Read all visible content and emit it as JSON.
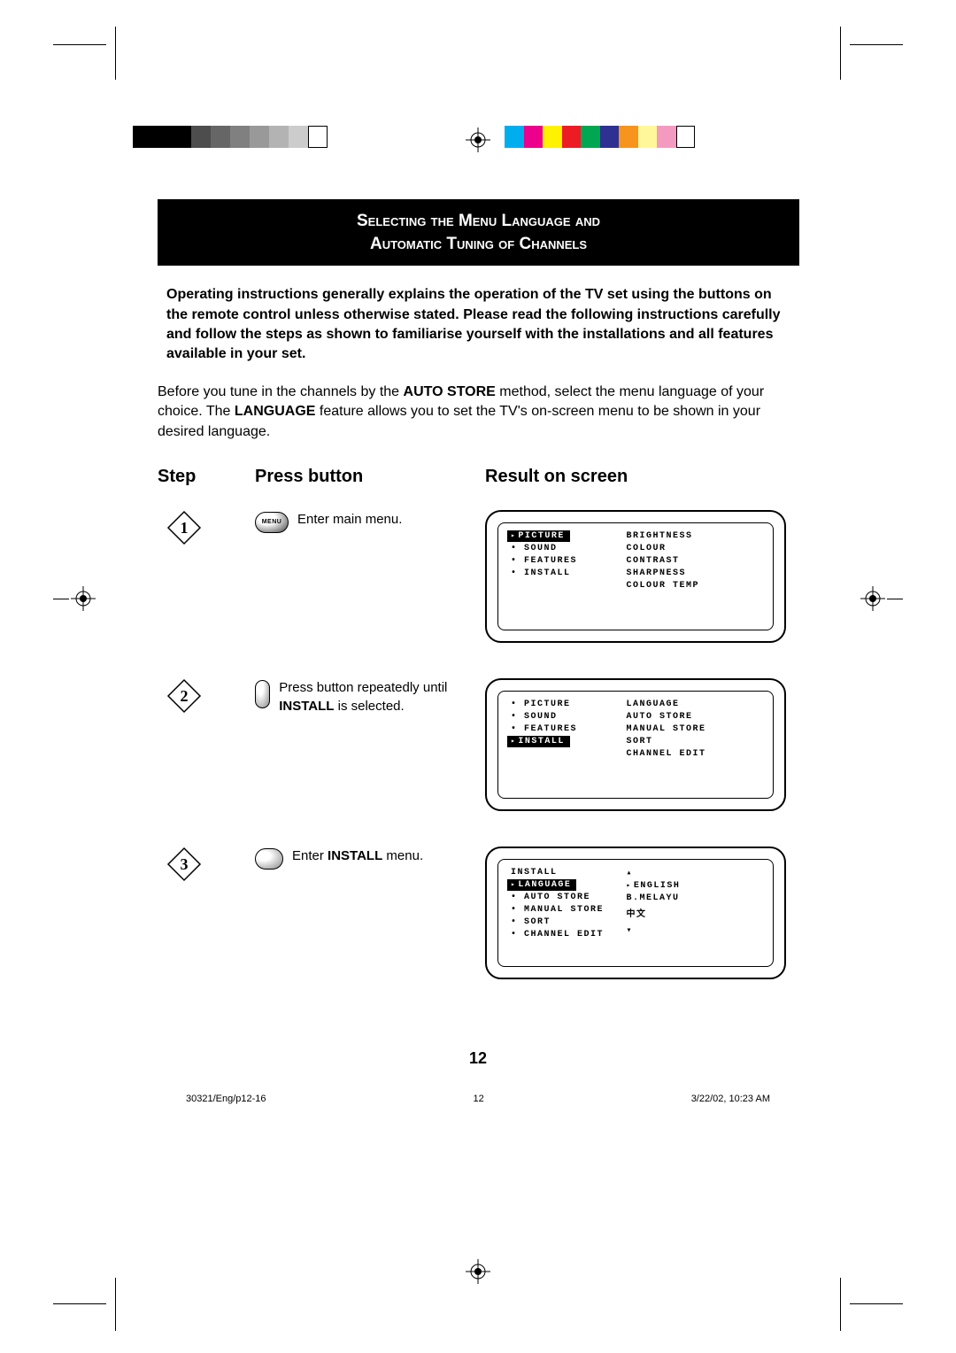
{
  "title_line1": "Selecting the Menu Language  and",
  "title_line2": "Automatic Tuning of Channels",
  "intro_bold": "Operating instructions generally explains the operation of the TV set using the buttons on the remote control unless otherwise stated.  Please read the following instructions carefully and follow the steps as shown to familiarise yourself with the installations and all features available in your set.",
  "intro_pre": "Before you tune in the channels by the ",
  "intro_bold2": "AUTO STORE",
  "intro_mid": " method, select the menu language of your choice.  The ",
  "intro_bold3": "LANGUAGE",
  "intro_post": " feature allows you to set the TV's on-screen menu to be shown in your desired language.",
  "headers": {
    "step": "Step",
    "press": "Press button",
    "result": "Result on screen"
  },
  "steps": {
    "s1": {
      "num": "1",
      "btn_label": "MENU",
      "text": "Enter main menu."
    },
    "s2": {
      "num": "2",
      "text_pre": "Press button repeatedly until ",
      "text_bold": "INSTALL",
      "text_post": " is selected."
    },
    "s3": {
      "num": "3",
      "text_pre": "Enter ",
      "text_bold": "INSTALL",
      "text_post": " menu."
    }
  },
  "screen1": {
    "left": [
      "PICTURE",
      "SOUND",
      "FEATURES",
      "INSTALL"
    ],
    "left_sel": 0,
    "right": [
      "BRIGHTNESS",
      "COLOUR",
      "CONTRAST",
      "SHARPNESS",
      "COLOUR TEMP"
    ]
  },
  "screen2": {
    "left": [
      "PICTURE",
      "SOUND",
      "FEATURES",
      "INSTALL"
    ],
    "left_sel": 3,
    "right": [
      "LANGUAGE",
      "AUTO STORE",
      "MANUAL STORE",
      "SORT",
      "CHANNEL EDIT"
    ]
  },
  "screen3": {
    "left": [
      "INSTALL",
      "LANGUAGE",
      "AUTO STORE",
      "MANUAL STORE",
      "SORT",
      "CHANNEL EDIT"
    ],
    "left_sel": 1,
    "right": [
      "▴",
      "ENGLISH",
      "B.MELAYU",
      "中文",
      "",
      "▾"
    ],
    "right_sel": 1
  },
  "page_number": "12",
  "footer": {
    "left": "30321/Eng/p12-16",
    "center": "12",
    "right": "3/22/02, 10:23 AM"
  },
  "gray_swatches": [
    "#000",
    "#000",
    "#000",
    "#4d4d4d",
    "#666",
    "#808080",
    "#999",
    "#b3b3b3",
    "#ccc",
    "#fff"
  ],
  "color_swatches": [
    "#00aeef",
    "#ec008c",
    "#fff200",
    "#ed1c24",
    "#00a651",
    "#2e3192",
    "#f7941d",
    "#fff799",
    "#f49ac1",
    "#fff"
  ]
}
